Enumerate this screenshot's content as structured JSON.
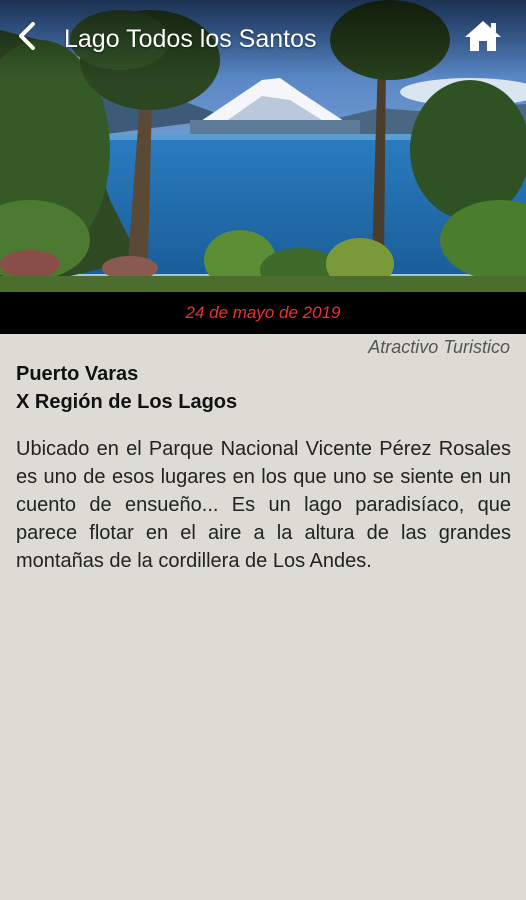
{
  "header": {
    "title": "Lago Todos los Santos",
    "back_icon": "chevron-left-icon",
    "home_icon": "home-icon"
  },
  "hero": {
    "image": "lake-mountain-photo"
  },
  "date": "24 de mayo de 2019",
  "category": "Atractivo Turistico",
  "location": {
    "city": "Puerto Varas",
    "region": "X Región de Los Lagos"
  },
  "description": "Ubicado en el Parque Nacional Vicente Pérez Rosales es uno de esos lugares en los que uno se siente en un cuento de ensueño... Es un lago paradisíaco, que parece flotar en el aire a la altura de las grandes montañas de la cordillera de Los Andes.",
  "colors": {
    "date_text": "#e8322f",
    "date_bar": "#000000",
    "background": "#dcdcd4"
  }
}
